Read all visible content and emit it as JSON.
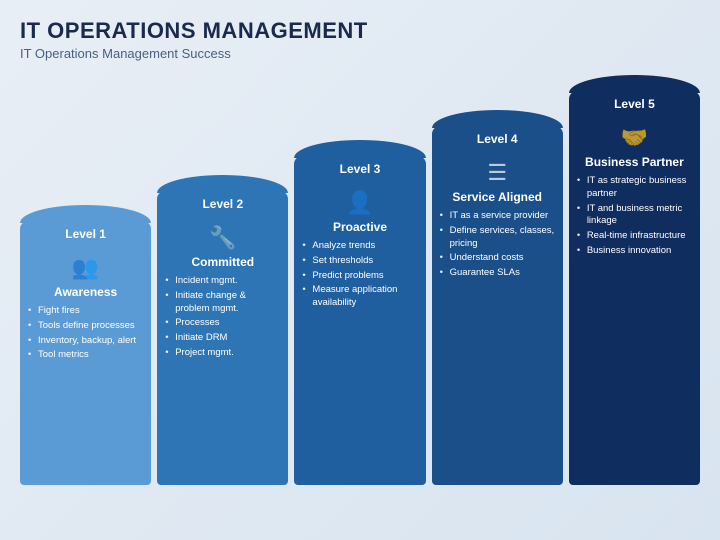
{
  "header": {
    "title": "IT OPERATIONS MANAGEMENT",
    "subtitle": "IT Operations Management Success"
  },
  "levels": [
    {
      "id": "level1",
      "tab_label": "Level 1",
      "sublabel": "Awareness",
      "color_class": "lv1",
      "icon": "👥",
      "bullets": [
        "Fight fires",
        "Tools define processes",
        "Inventory, backup, alert",
        "Tool metrics"
      ]
    },
    {
      "id": "level2",
      "tab_label": "Level 2",
      "sublabel": "Committed",
      "color_class": "lv2",
      "icon": "🔧",
      "bullets": [
        "Incident mgmt.",
        "Initiate change & problem mgmt.",
        "Processes",
        "Initiate DRM",
        "Project mgmt."
      ]
    },
    {
      "id": "level3",
      "tab_label": "Level 3",
      "sublabel": "Proactive",
      "color_class": "lv3",
      "icon": "👤",
      "bullets": [
        "Analyze trends",
        "Set thresholds",
        "Predict problems",
        "Measure application availability"
      ]
    },
    {
      "id": "level4",
      "tab_label": "Level 4",
      "sublabel": "Service Aligned",
      "color_class": "lv4",
      "icon": "☰",
      "bullets": [
        "IT as a service provider",
        "Define services, classes, pricing",
        "Understand costs",
        "Guarantee SLAs"
      ]
    },
    {
      "id": "level5",
      "tab_label": "Level 5",
      "sublabel": "Business Partner",
      "color_class": "lv5",
      "icon": "🤝",
      "bullets": [
        "IT as strategic business partner",
        "IT and business metric linkage",
        "Real-time infrastructure",
        "Business innovation"
      ]
    }
  ]
}
